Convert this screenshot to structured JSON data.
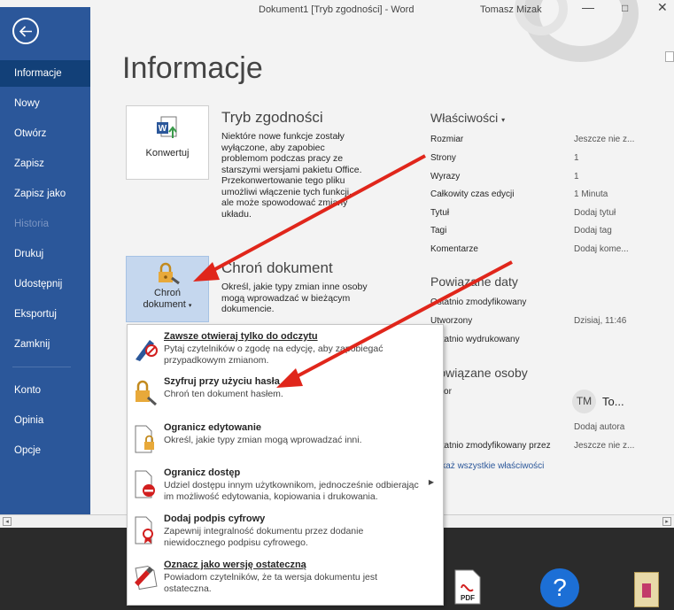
{
  "window": {
    "title": "Dokument1 [Tryb zgodności] - Word",
    "user": "Tomasz Mizak"
  },
  "nav": {
    "items": [
      {
        "label": "Informacje"
      },
      {
        "label": "Nowy"
      },
      {
        "label": "Otwórz"
      },
      {
        "label": "Zapisz"
      },
      {
        "label": "Zapisz jako"
      },
      {
        "label": "Historia"
      },
      {
        "label": "Drukuj"
      },
      {
        "label": "Udostępnij"
      },
      {
        "label": "Eksportuj"
      },
      {
        "label": "Zamknij"
      },
      {
        "label": "Konto"
      },
      {
        "label": "Opinia"
      },
      {
        "label": "Opcje"
      }
    ]
  },
  "page_title": "Informacje",
  "compat": {
    "button_label": "Konwertuj",
    "title": "Tryb zgodności",
    "desc": [
      "Niektóre nowe funkcje zostały",
      "wyłączone, aby zapobiec",
      "problemom podczas pracy ze",
      "starszymi wersjami pakietu Office.",
      "Przekonwertowanie tego pliku",
      "umożliwi włączenie tych funkcji,",
      "ale może spowodować zmiany",
      "układu."
    ]
  },
  "protect": {
    "button_label_1": "Chroń",
    "button_label_2": "dokument",
    "title": "Chroń dokument",
    "desc": [
      "Określ, jakie typy zmian inne osoby",
      "mogą wprowadzać w bieżącym",
      "dokumencie."
    ]
  },
  "properties": {
    "title": "Właściwości",
    "rows": [
      {
        "label": "Rozmiar",
        "value": "Jeszcze nie z..."
      },
      {
        "label": "Strony",
        "value": "1"
      },
      {
        "label": "Wyrazy",
        "value": "1"
      },
      {
        "label": "Całkowity czas edycji",
        "value": "1 Minuta"
      },
      {
        "label": "Tytuł",
        "value": "Dodaj tytuł"
      },
      {
        "label": "Tagi",
        "value": "Dodaj tag"
      },
      {
        "label": "Komentarze",
        "value": "Dodaj kome..."
      }
    ]
  },
  "dates": {
    "title": "Powiązane daty",
    "last_modified": "Ostatnio zmodyfikowany",
    "created": "Utworzony",
    "created_value": "Dzisiaj, 11:46",
    "last_printed": "Ostatnio wydrukowany"
  },
  "people": {
    "title": "Powiązane osoby",
    "author": "Autor",
    "avatar_initials": "TM",
    "author_name": "To...",
    "add_author": "Dodaj autora",
    "last_modified_by": "Ostatnio zmodyfikowany przez",
    "last_modified_by_value": "Jeszcze nie z..."
  },
  "show_all": "Pokaż wszystkie właściwości",
  "menu": {
    "items": [
      {
        "title": "Zawsze otwieraj tylko do odczytu",
        "desc": [
          "Pytaj czytelników o zgodę na edycję, aby zapobiegać",
          "przypadkowym zmianom."
        ],
        "icon": "pen-no-icon"
      },
      {
        "title": "Szyfruj przy użyciu hasła",
        "desc": [
          "Chroń ten dokument hasłem."
        ],
        "icon": "lock-key-icon"
      },
      {
        "title": "Ogranicz edytowanie",
        "desc": [
          "Określ, jakie typy zmian mogą wprowadzać inni."
        ],
        "icon": "doc-lock-icon"
      },
      {
        "title": "Ogranicz dostęp",
        "desc": [
          "Udziel dostępu innym użytkownikom, jednocześnie odbierając",
          "im możliwość edytowania, kopiowania i drukowania."
        ],
        "icon": "doc-restrict-icon"
      },
      {
        "title": "Dodaj podpis cyfrowy",
        "desc": [
          "Zapewnij integralność dokumentu przez dodanie",
          "niewidocznego podpisu cyfrowego."
        ],
        "icon": "doc-ribbon-icon"
      },
      {
        "title": "Oznacz jako wersję ostateczną",
        "desc": [
          "Powiadom czytelników, że ta wersja dokumentu jest",
          "ostateczna."
        ],
        "icon": "doc-final-icon"
      }
    ]
  },
  "taskbar": {
    "pdf_label": "PDF",
    "help_glyph": "?"
  },
  "colors": {
    "nav_blue": "#2b579a",
    "nav_active": "#124078",
    "arrow_red": "#e0261b",
    "accent": "#2b579a"
  }
}
